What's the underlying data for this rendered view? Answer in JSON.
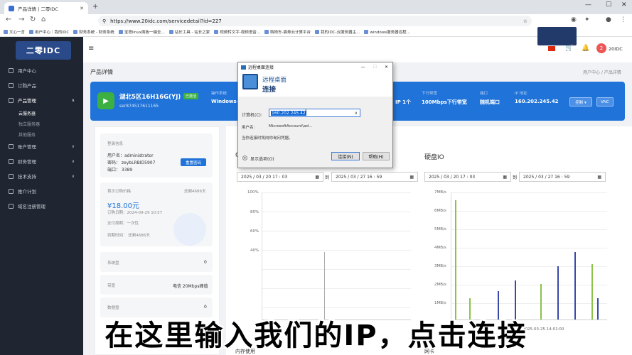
{
  "browser": {
    "tab_title": "产品详情 | 二零IDC",
    "url": "https://www.20idc.com/servicedetail?id=227"
  },
  "bookmarks": [
    "文心一言",
    "用户中心｜我的IDC",
    "财务系统 - 财务系统",
    "宝塔linux面板一键全...",
    "站长工具 - 站长之家",
    "视频转文字-视频语音...",
    "购物车-猫寿云计算平台",
    "我的IDC-云服务器主...",
    "windows服务器远程..."
  ],
  "sidebar": {
    "logo": "二零IDC",
    "items": [
      {
        "label": "用户中心"
      },
      {
        "label": "订购产品"
      },
      {
        "label": "产品管理"
      },
      {
        "label": "账户管理"
      },
      {
        "label": "财务管理"
      },
      {
        "label": "技术支持"
      },
      {
        "label": "推介计划"
      },
      {
        "label": "域名注册管理"
      }
    ],
    "subs": [
      "云服务器",
      "独立服务器",
      "其他服务"
    ]
  },
  "header": {
    "username": "20IDC",
    "avatar": "2"
  },
  "page": {
    "title": "产品详情",
    "breadcrumb": "用户中心 / 产品详情"
  },
  "product": {
    "name": "湖北5区16H16G(YJ)",
    "status": "已激活",
    "id": "ser874517611165",
    "os_label": "操作系统",
    "os": "Windows-",
    "cpu": "IP 1个",
    "bw_label": "下行带宽",
    "bw": "100Mbps下行带宽",
    "port_label": "端口",
    "port": "随机端口",
    "ip_label": "IP 地址",
    "ip": "160.202.245.42",
    "btn_control": "控制 ▾",
    "btn_vnc": "VNC"
  },
  "login": {
    "title": "登录信息",
    "user": "用户名：administrator",
    "pass": "密码：  zeybLRBID5907",
    "port": "端口：  3389",
    "reset": "重置密码"
  },
  "billing": {
    "title": "首次订购价格",
    "renew": "还剩4686天",
    "price": "¥18.00元",
    "date": "订购日期：2024-09-29 10:57",
    "cycle": "支付周期：一次性",
    "expire": "到期时间：  还剩4686天"
  },
  "specs": [
    {
      "k": "系统盘",
      "v": "0"
    },
    {
      "k": "带宽",
      "v": "电信 20Mbps峰值"
    },
    {
      "k": "数据盘",
      "v": "0"
    }
  ],
  "charts": {
    "cpu_title": "C",
    "io_title": "硬盘IO",
    "net_title": "网卡",
    "mem_title": "内存使用",
    "dates": [
      "2025 / 03 / 20   17 : 03",
      "2025 / 03 / 27   16 : 59"
    ],
    "to": "到",
    "cpu_y": [
      "100%",
      "80%",
      "60%",
      "40%"
    ],
    "io_y": [
      "7MB/s",
      "6MB/s",
      "5MB/s",
      "4MB/s",
      "3MB/s",
      "2MB/s",
      "1MB/s"
    ],
    "x_tick": "2025-03-25 14:01:00"
  },
  "dialog": {
    "title": "远程桌面连接",
    "h1": "远程桌面",
    "h2": "连接",
    "comp_label": "计算机(C):",
    "comp": "160.202.245.42",
    "user_label": "用户名:",
    "user": "MicrosoftAccount\\ad...",
    "note": "当你连接时将向你询问凭据。",
    "options": "显示选项(O)",
    "connect": "连接(N)",
    "help": "帮助(H)"
  },
  "subtitle": "在这里输入我们的IP，点击连接"
}
